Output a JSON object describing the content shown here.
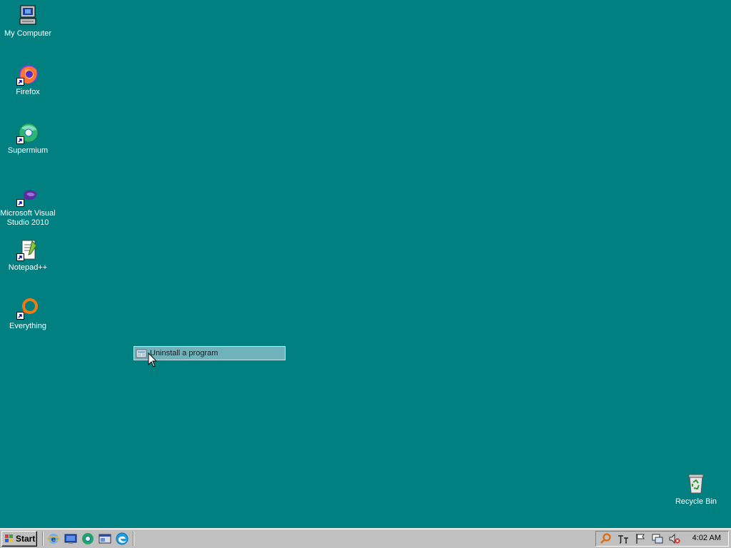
{
  "desktop": {
    "background_color": "#008080",
    "icons": [
      {
        "label": "My Computer",
        "icon": "computer-icon"
      },
      {
        "label": "Firefox",
        "icon": "firefox-icon"
      },
      {
        "label": "Supermium",
        "icon": "supermium-icon"
      },
      {
        "label": "Microsoft Visual Studio 2010",
        "icon": "visual-studio-icon"
      },
      {
        "label": "Notepad++",
        "icon": "notepadpp-icon"
      },
      {
        "label": "Everything",
        "icon": "everything-icon"
      },
      {
        "label": "Recycle Bin",
        "icon": "recycle-bin-icon"
      }
    ]
  },
  "drag_item": {
    "label": "Uninstall a program",
    "icon": "programs-icon"
  },
  "taskbar": {
    "start_label": "Start",
    "quick_launch": [
      "ie-icon",
      "show-desktop-icon",
      "supermium-icon",
      "explorer-icon",
      "edge-icon"
    ],
    "tray_icons": [
      "search-icon",
      "input-method-icon",
      "flag-icon",
      "network-icon",
      "volume-muted-icon"
    ],
    "clock": "4:02 AM"
  }
}
